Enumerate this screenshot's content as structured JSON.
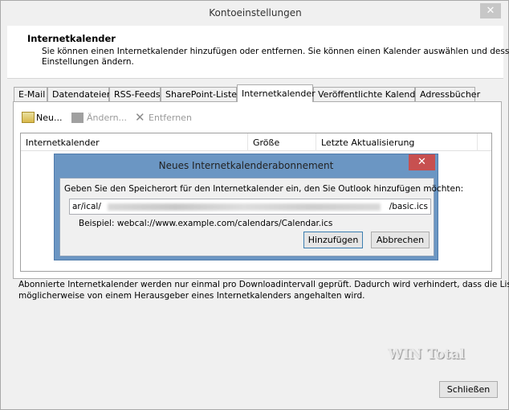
{
  "window": {
    "title": "Kontoeinstellungen",
    "close": "✕"
  },
  "header": {
    "title": "Internetkalender",
    "description_line1": "Sie können einen Internetkalender hinzufügen oder entfernen. Sie können einen Kalender auswählen und dessen",
    "description_line2": "Einstellungen ändern."
  },
  "tabs": [
    "E-Mail",
    "Datendateien",
    "RSS-Feeds",
    "SharePoint-Listen",
    "Internetkalender",
    "Veröffentlichte Kalender",
    "Adressbücher"
  ],
  "toolbar": {
    "new": "Neu...",
    "change": "Ändern...",
    "remove": "Entfernen"
  },
  "list": {
    "columns": [
      "Internetkalender",
      "Größe",
      "Letzte Aktualisierung"
    ]
  },
  "dialog": {
    "title": "Neues Internetkalenderabonnement",
    "close": "✕",
    "prompt": "Geben Sie den Speicherort für den Internetkalender ein, den Sie Outlook hinzufügen möchten:",
    "url_start": "ar/ical/",
    "url_end": "/basic.ics",
    "example": "Beispiel: webcal://www.example.com/calendars/Calendar.ics",
    "add": "Hinzufügen",
    "cancel": "Abbrechen"
  },
  "footer": {
    "line1": "Abonnierte Internetkalender werden nur einmal pro Downloadintervall geprüft. Dadurch wird verhindert, dass die Liste",
    "line2": "möglicherweise von einem Herausgeber eines Internetkalenders angehalten wird.",
    "close_button": "Schließen"
  },
  "watermark": "WIN Total"
}
